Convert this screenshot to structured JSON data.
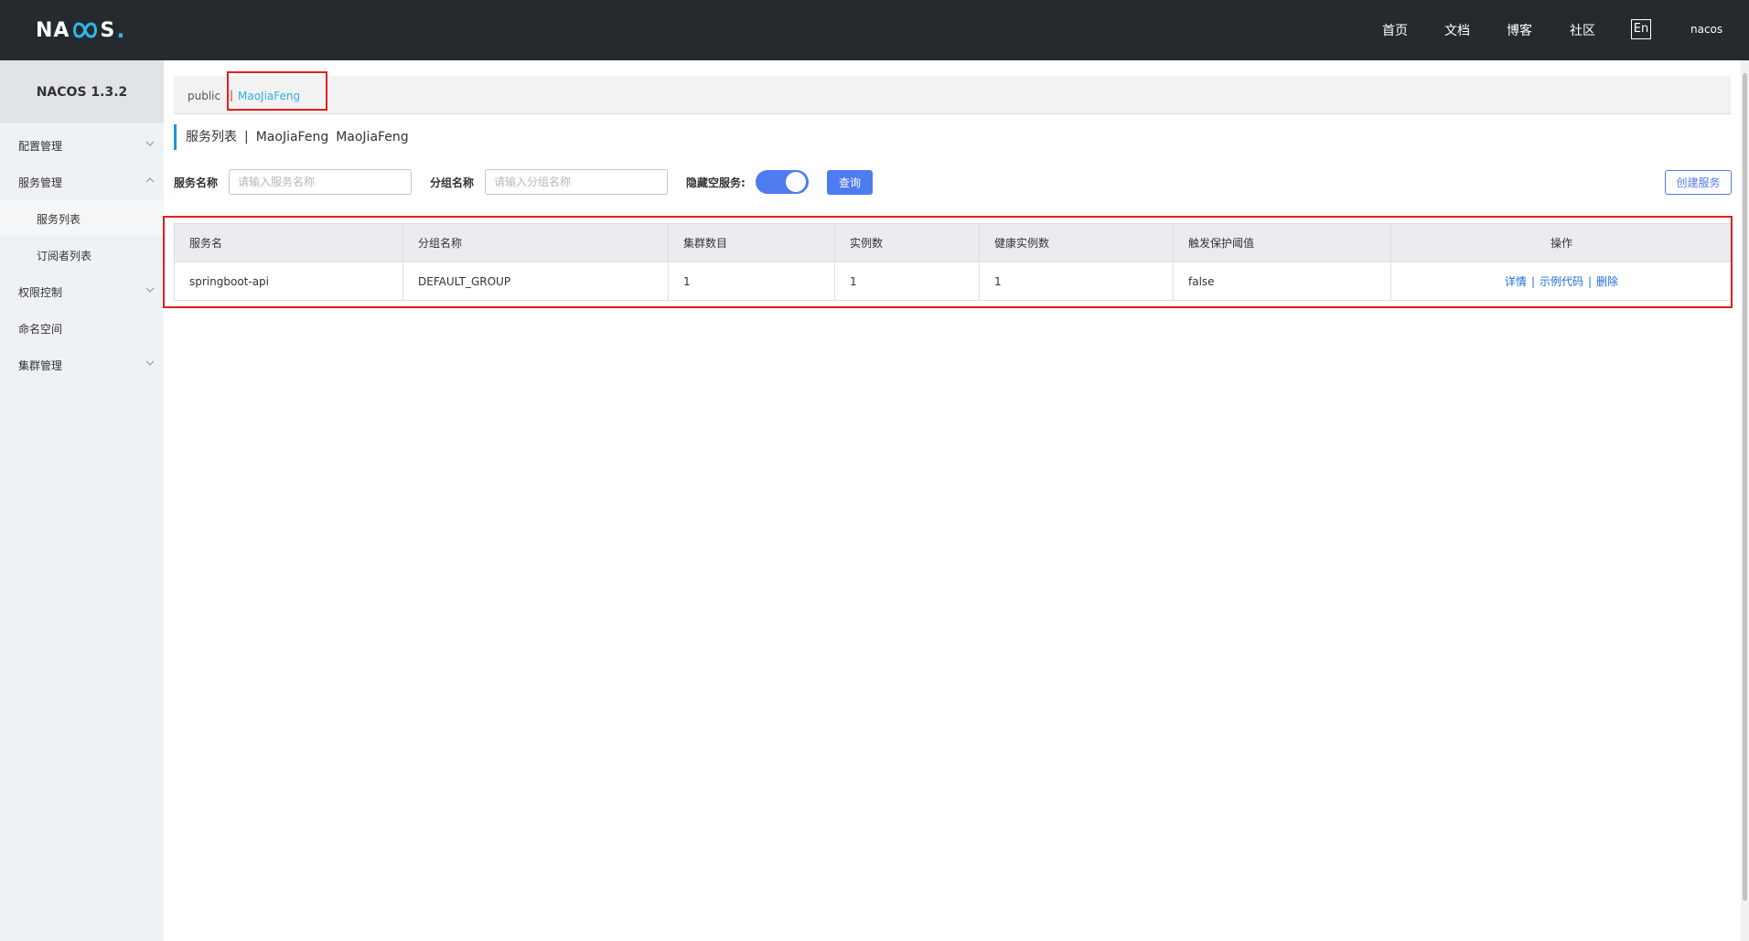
{
  "header": {
    "logo_left": "NA",
    "logo_right": "S",
    "logo_dot": ".",
    "nav": [
      {
        "label": "首页"
      },
      {
        "label": "文档"
      },
      {
        "label": "博客"
      },
      {
        "label": "社区"
      }
    ],
    "language_button": "En",
    "user": "nacos"
  },
  "sidebar": {
    "brand": "NACOS 1.3.2",
    "items": [
      {
        "label": "配置管理",
        "expanded": false
      },
      {
        "label": "服务管理",
        "expanded": true
      },
      {
        "label": "服务列表",
        "active": true
      },
      {
        "label": "订阅者列表"
      },
      {
        "label": "权限控制",
        "expanded": false
      },
      {
        "label": "命名空间"
      },
      {
        "label": "集群管理",
        "expanded": false
      }
    ]
  },
  "namespaces": {
    "items": [
      "public",
      "MaoJiaFeng"
    ],
    "separator": "|",
    "current": "MaoJiaFeng"
  },
  "page": {
    "title": "服务列表",
    "title_separator": "|",
    "namespace_name": "MaoJiaFeng",
    "namespace_id": "MaoJiaFeng"
  },
  "filters": {
    "service_name_label": "服务名称",
    "service_name_placeholder": "请输入服务名称",
    "group_name_label": "分组名称",
    "group_name_placeholder": "请输入分组名称",
    "hide_empty_label": "隐藏空服务:",
    "hide_empty_value": true,
    "query_button": "查询",
    "create_button": "创建服务"
  },
  "table": {
    "columns": [
      "服务名",
      "分组名称",
      "集群数目",
      "实例数",
      "健康实例数",
      "触发保护阈值",
      "操作"
    ],
    "rows": [
      {
        "service_name": "springboot-api",
        "group_name": "DEFAULT_GROUP",
        "cluster_count": "1",
        "instance_count": "1",
        "healthy_instance_count": "1",
        "protect_threshold": "false",
        "actions": [
          "详情",
          "示例代码",
          "删除"
        ],
        "action_separator": "|"
      }
    ]
  },
  "colors": {
    "header_bg": "#252a2f",
    "sidebar_bg": "#eef1f5",
    "primary": "#4f7bf0",
    "link": "#1f6fe0",
    "namespace_active": "#2eb1e0",
    "highlight_box": "#e0201e"
  }
}
